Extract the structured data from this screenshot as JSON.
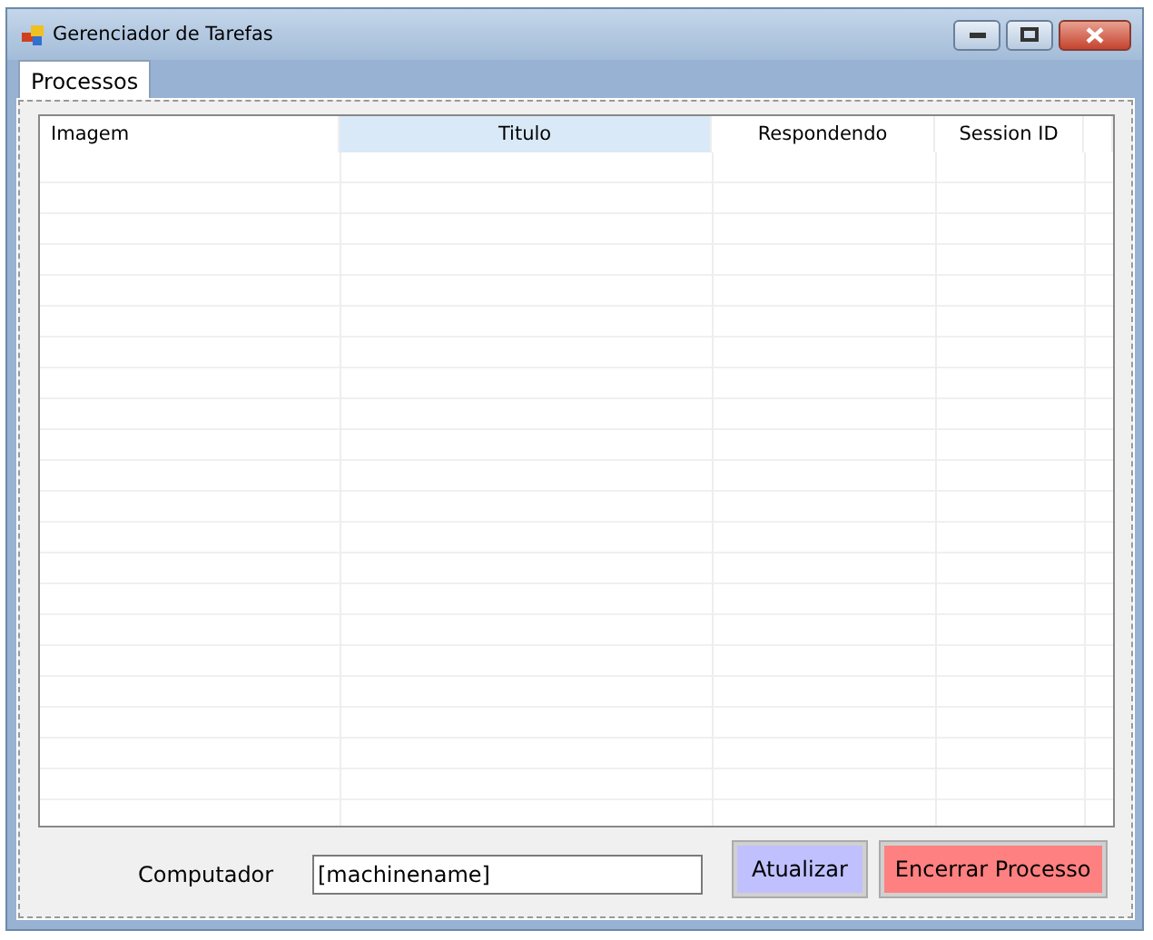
{
  "window": {
    "title": "Gerenciador de Tarefas"
  },
  "tabs": [
    {
      "label": "Processos",
      "selected": true
    }
  ],
  "table": {
    "columns": [
      {
        "label": "Imagem",
        "selected": false
      },
      {
        "label": "Titulo",
        "selected": true
      },
      {
        "label": "Respondendo",
        "selected": false
      },
      {
        "label": "Session ID",
        "selected": false
      }
    ]
  },
  "computer": {
    "label": "Computador",
    "value": "[machinename]"
  },
  "buttons": [
    {
      "label": "Atualizar",
      "color": "#c0c0ff"
    },
    {
      "label": "Encerrar Processo",
      "color": "#ff8080"
    }
  ]
}
